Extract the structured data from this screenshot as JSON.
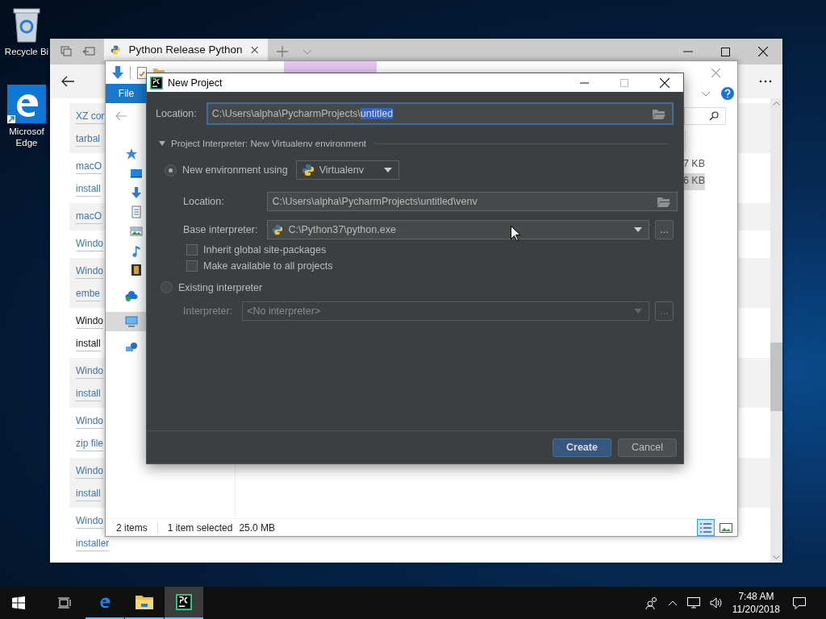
{
  "desktop": {
    "icons": [
      {
        "kind": "recycle-bin",
        "lines": [
          "Recycle Bi"
        ]
      },
      {
        "kind": "edge",
        "lines": [
          "Microsof",
          "Edge"
        ]
      }
    ]
  },
  "browser": {
    "tab": {
      "title": "Python Release Python",
      "selected": true
    },
    "links": [
      {
        "lines": [
          "XZ cor",
          "tarbal"
        ],
        "shaded": true,
        "hovered": false
      },
      {
        "lines": [
          "macO",
          "install"
        ],
        "shaded": false,
        "hovered": false
      },
      {
        "lines": [
          "macO"
        ],
        "shaded": true,
        "hovered": false
      },
      {
        "lines": [
          "Windo"
        ],
        "shaded": false,
        "hovered": false
      },
      {
        "lines": [
          "Windo",
          "embe"
        ],
        "shaded": true,
        "hovered": false
      },
      {
        "lines": [
          "Windo",
          "install"
        ],
        "shaded": false,
        "hovered": true
      },
      {
        "lines": [
          "Windo",
          "install"
        ],
        "shaded": true,
        "hovered": false
      },
      {
        "lines": [
          "Windo",
          "zip file"
        ],
        "shaded": false,
        "hovered": false
      },
      {
        "lines": [
          "Windo",
          "install"
        ],
        "shaded": true,
        "hovered": false
      },
      {
        "lines": [
          "Windo",
          "installer"
        ],
        "shaded": false,
        "hovered": false
      }
    ]
  },
  "explorer": {
    "ribbon_tab": "File",
    "nav": [
      {
        "kind": "quick-access",
        "selected": false,
        "children": [
          {
            "kind": "desktop",
            "selected": false
          },
          {
            "kind": "downloads",
            "selected": false
          },
          {
            "kind": "documents",
            "selected": false
          },
          {
            "kind": "pictures",
            "selected": false
          },
          {
            "kind": "music",
            "selected": false
          },
          {
            "kind": "videos",
            "selected": false
          }
        ]
      },
      {
        "kind": "onedrive",
        "selected": false
      },
      {
        "kind": "this-pc",
        "selected": true
      },
      {
        "kind": "network",
        "selected": false
      }
    ],
    "sizes": [
      {
        "text": "7 KB",
        "selected": false
      },
      {
        "text": "6 KB",
        "selected": true
      }
    ],
    "status": {
      "count": "2 items",
      "selection": "1 item selected",
      "size": "25.0 MB"
    },
    "views": [
      {
        "kind": "details",
        "selected": true
      },
      {
        "kind": "tiles",
        "selected": false
      }
    ]
  },
  "dialog": {
    "title": "New Project",
    "location_label": "Location:",
    "location_path": "C:\\Users\\alpha\\PycharmProjects\\",
    "location_selected": "untitled",
    "section": {
      "title": "Project Interpreter: New Virtualenv environment",
      "expanded": true
    },
    "options": [
      {
        "label": "New environment using",
        "selected": true,
        "tool": "Virtualenv",
        "fields": [
          {
            "kind": "path",
            "label": "Location:",
            "value": "C:\\Users\\alpha\\PycharmProjects\\untitled\\venv",
            "disabled": false
          },
          {
            "kind": "dropdown",
            "label": "Base interpreter:",
            "value": "C:\\Python37\\python.exe",
            "disabled": false,
            "browse": "..."
          }
        ],
        "checkboxes": [
          {
            "label": "Inherit global site-packages",
            "checked": false
          },
          {
            "label": "Make available to all projects",
            "checked": false
          }
        ]
      },
      {
        "label": "Existing interpreter",
        "selected": false,
        "fields": [
          {
            "kind": "dropdown",
            "label": "Interpreter:",
            "value": "<No interpreter>",
            "disabled": true,
            "browse": "..."
          }
        ]
      }
    ],
    "buttons": [
      {
        "label": "Create",
        "kind": "primary"
      },
      {
        "label": "Cancel",
        "kind": "secondary"
      }
    ]
  },
  "taskbar": {
    "apps": [
      {
        "kind": "edge",
        "running": true,
        "selected": false
      },
      {
        "kind": "folder",
        "running": true,
        "selected": false
      },
      {
        "kind": "pycharm",
        "running": true,
        "selected": true
      }
    ],
    "time": "7:48 AM",
    "date": "11/20/2018"
  }
}
